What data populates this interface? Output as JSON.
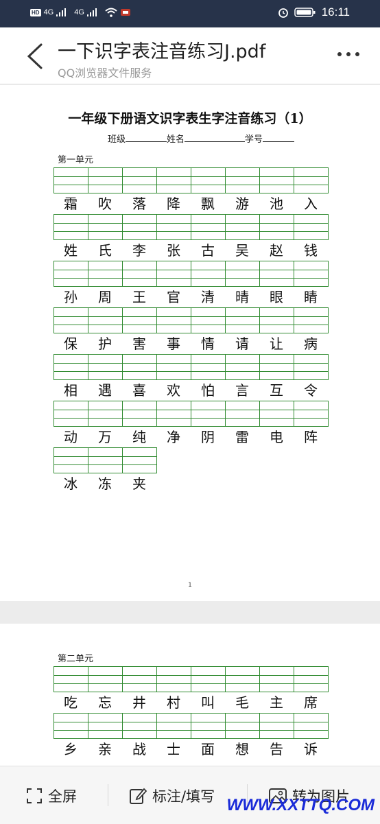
{
  "status_bar": {
    "left_badge": "HD",
    "net1": "4G",
    "net2": "4G",
    "time": "16:11"
  },
  "header": {
    "title": "一下识字表注音练习J.pdf",
    "subtitle": "QQ浏览器文件服务"
  },
  "document": {
    "title": "一年级下册语文识字表生字注音练习（1）",
    "info": {
      "class_label": "班级",
      "name_label": "姓名",
      "id_label": "学号"
    },
    "page1_unit": "第一单元",
    "page1_rows": [
      [
        "霜",
        "吹",
        "落",
        "降",
        "飘",
        "游",
        "池",
        "入"
      ],
      [
        "姓",
        "氏",
        "李",
        "张",
        "古",
        "吴",
        "赵",
        "钱"
      ],
      [
        "孙",
        "周",
        "王",
        "官",
        "清",
        "晴",
        "眼",
        "睛"
      ],
      [
        "保",
        "护",
        "害",
        "事",
        "情",
        "请",
        "让",
        "病"
      ],
      [
        "相",
        "遇",
        "喜",
        "欢",
        "怕",
        "言",
        "互",
        "令"
      ],
      [
        "动",
        "万",
        "纯",
        "净",
        "阴",
        "雷",
        "电",
        "阵"
      ],
      [
        "冰",
        "冻",
        "夹"
      ]
    ],
    "page_number": "1",
    "page2_unit": "第二单元",
    "page2_rows": [
      [
        "吃",
        "忘",
        "井",
        "村",
        "叫",
        "毛",
        "主",
        "席"
      ],
      [
        "乡",
        "亲",
        "战",
        "士",
        "面",
        "想",
        "告",
        "诉"
      ]
    ]
  },
  "bottom_bar": {
    "fullscreen": "全屏",
    "annotate": "标注/填写",
    "to_image": "转为图片"
  },
  "watermark": "WWW.XXTTQ.COM"
}
